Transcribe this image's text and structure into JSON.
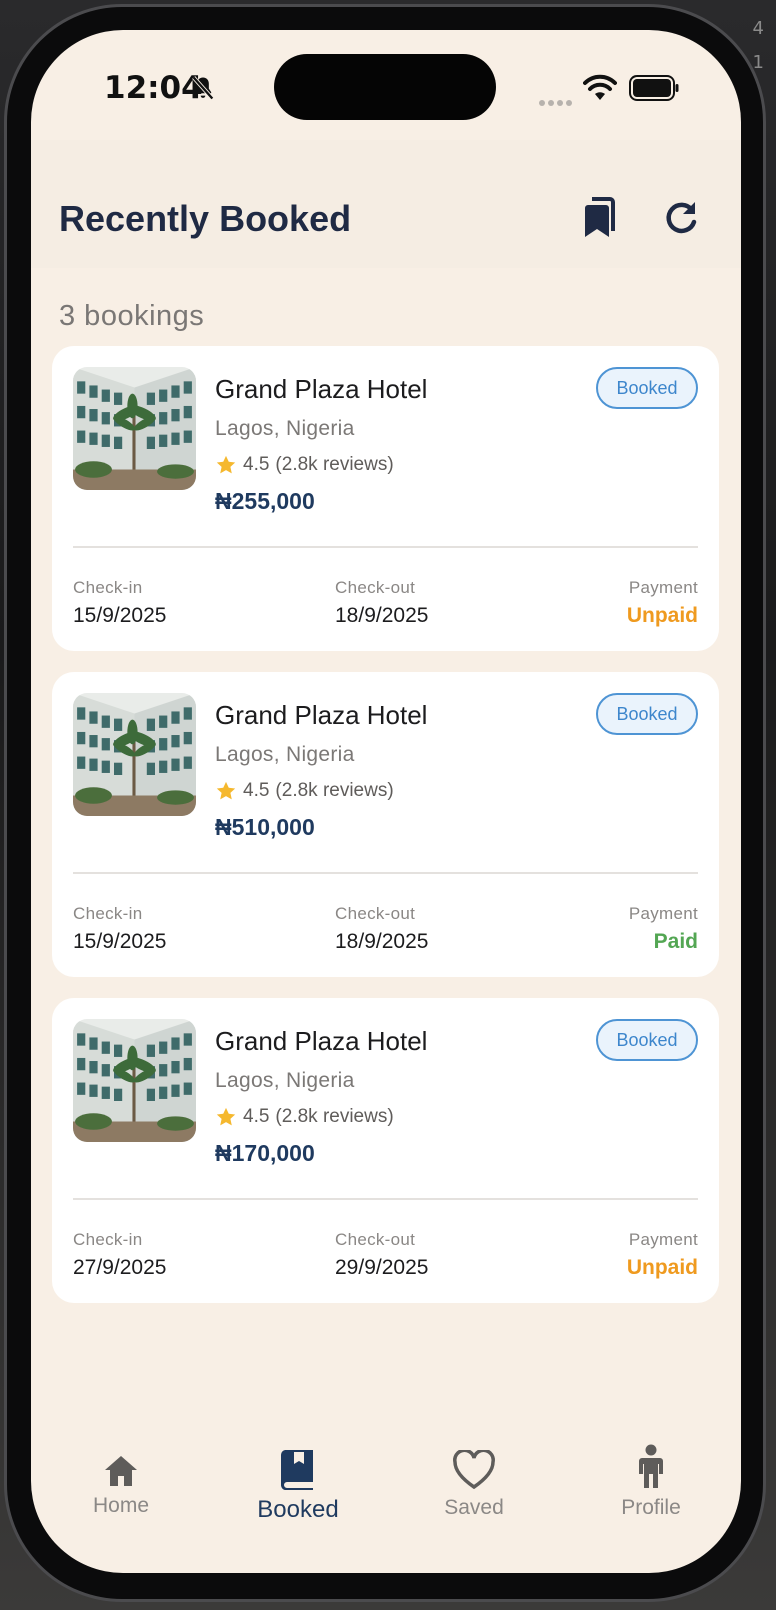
{
  "status_bar": {
    "time": "12:04"
  },
  "side_numbers": [
    "4",
    "1"
  ],
  "header": {
    "title": "Recently Booked"
  },
  "summary": {
    "count_text": "3 bookings"
  },
  "bookings": [
    {
      "name": "Grand Plaza Hotel",
      "location": "Lagos, Nigeria",
      "rating": "4.5",
      "reviews": "(2.8k reviews)",
      "price": "₦255,000",
      "badge": "Booked",
      "checkin_label": "Check-in",
      "checkin": "15/9/2025",
      "checkout_label": "Check-out",
      "checkout": "18/9/2025",
      "payment_label": "Payment",
      "payment": "Unpaid"
    },
    {
      "name": "Grand Plaza Hotel",
      "location": "Lagos, Nigeria",
      "rating": "4.5",
      "reviews": "(2.8k reviews)",
      "price": "₦510,000",
      "badge": "Booked",
      "checkin_label": "Check-in",
      "checkin": "15/9/2025",
      "checkout_label": "Check-out",
      "checkout": "18/9/2025",
      "payment_label": "Payment",
      "payment": "Paid"
    },
    {
      "name": "Grand Plaza Hotel",
      "location": "Lagos, Nigeria",
      "rating": "4.5",
      "reviews": "(2.8k reviews)",
      "price": "₦170,000",
      "badge": "Booked",
      "checkin_label": "Check-in",
      "checkin": "27/9/2025",
      "checkout_label": "Check-out",
      "checkout": "29/9/2025",
      "payment_label": "Payment",
      "payment": "Unpaid"
    }
  ],
  "nav": {
    "items": [
      {
        "label": "Home",
        "icon": "home-icon"
      },
      {
        "label": "Booked",
        "icon": "book-icon",
        "active": true
      },
      {
        "label": "Saved",
        "icon": "heart-icon"
      },
      {
        "label": "Profile",
        "icon": "person-icon"
      }
    ]
  },
  "colors": {
    "accent": "#1f3a5f",
    "background": "#f8efe5",
    "badge": "#4e94d4",
    "unpaid": "#ef9a1f",
    "paid": "#53a653",
    "star": "#f5b82e"
  }
}
